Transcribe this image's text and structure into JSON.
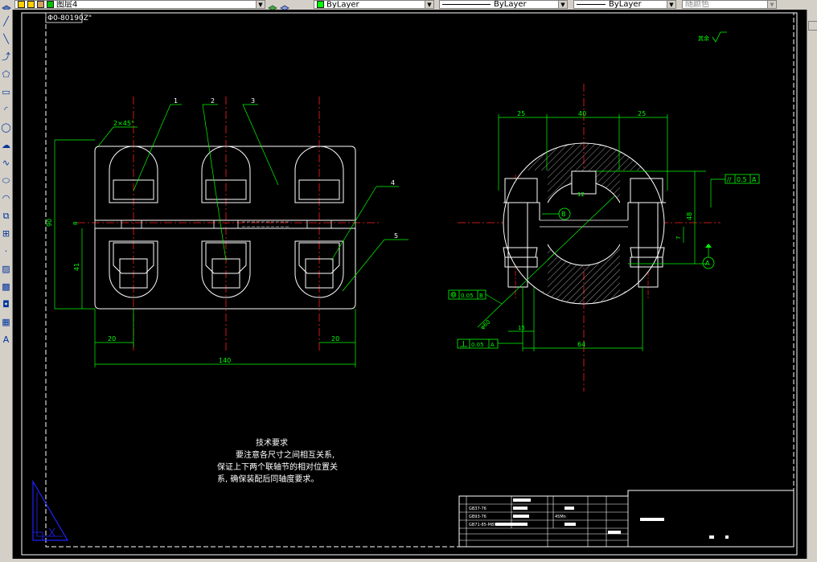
{
  "toolbar": {
    "layer_name": "图层4",
    "linetype1": "ByLayer",
    "linetype2": "ByLayer",
    "lineweight": "ByLayer",
    "color": "随颜色",
    "color_label": "ByLayer"
  },
  "left_tools": [
    {
      "icon": "line-icon",
      "glyph": "╱"
    },
    {
      "icon": "construction-line-icon",
      "glyph": "╲"
    },
    {
      "icon": "polyline-icon",
      "glyph": "⤴"
    },
    {
      "icon": "polygon-icon",
      "glyph": "⬠"
    },
    {
      "icon": "rectangle-icon",
      "glyph": "▭"
    },
    {
      "icon": "arc-icon",
      "glyph": "◜"
    },
    {
      "icon": "circle-icon",
      "glyph": "◯"
    },
    {
      "icon": "revision-cloud-icon",
      "glyph": "☁"
    },
    {
      "icon": "spline-icon",
      "glyph": "∿"
    },
    {
      "icon": "ellipse-icon",
      "glyph": "⬭"
    },
    {
      "icon": "ellipse-arc-icon",
      "glyph": "◠"
    },
    {
      "icon": "insert-block-icon",
      "glyph": "⧉"
    },
    {
      "icon": "make-block-icon",
      "glyph": "⊞"
    },
    {
      "icon": "point-icon",
      "glyph": "·"
    },
    {
      "icon": "hatch-icon",
      "glyph": "▨"
    },
    {
      "icon": "gradient-icon",
      "glyph": "▩"
    },
    {
      "icon": "region-icon",
      "glyph": "◘"
    },
    {
      "icon": "table-icon",
      "glyph": "▦"
    },
    {
      "icon": "mtext-icon",
      "glyph": "A"
    }
  ],
  "drawing": {
    "corner_label": "Φ0-80190Z\"",
    "roughness_note": "其余",
    "tech_req_title": "技术要求",
    "tech_req_lines": [
      "要注意各尺寸之间相互关系,",
      "保证上下两个联轴节的相对位置关",
      "系, 确保装配后同轴度要求。"
    ],
    "front_view": {
      "chamfer": "2×45°",
      "part_labels": [
        "1",
        "2",
        "3",
        "4",
        "5"
      ],
      "dims": {
        "height_total": "90",
        "height_lower": "41",
        "left_small": "8",
        "left_offset": "20",
        "right_offset": "20",
        "width": "140"
      }
    },
    "side_view": {
      "dims": {
        "left_top": "25",
        "middle_top": "40",
        "right_top": "25",
        "key_width": "12",
        "height_right": "48",
        "small_right": "7",
        "bolt_spacing": "64",
        "offset_bottom": "15",
        "diameter": "φ60"
      },
      "tolerances": {
        "parallel": "0.5",
        "parallel_datum": "A",
        "concentric": "0.05",
        "concentric_datum": "B",
        "perpendicular": "0.05",
        "perpendicular_datum": "A"
      },
      "datum_b": "B",
      "datum_a": "A"
    },
    "title_block_rows": [
      [
        "GB37-76",
        "",
        ""
      ],
      [
        "GB93-76",
        "",
        "45Mn"
      ],
      [
        "GB71-85-M8X20",
        "",
        ""
      ]
    ]
  }
}
